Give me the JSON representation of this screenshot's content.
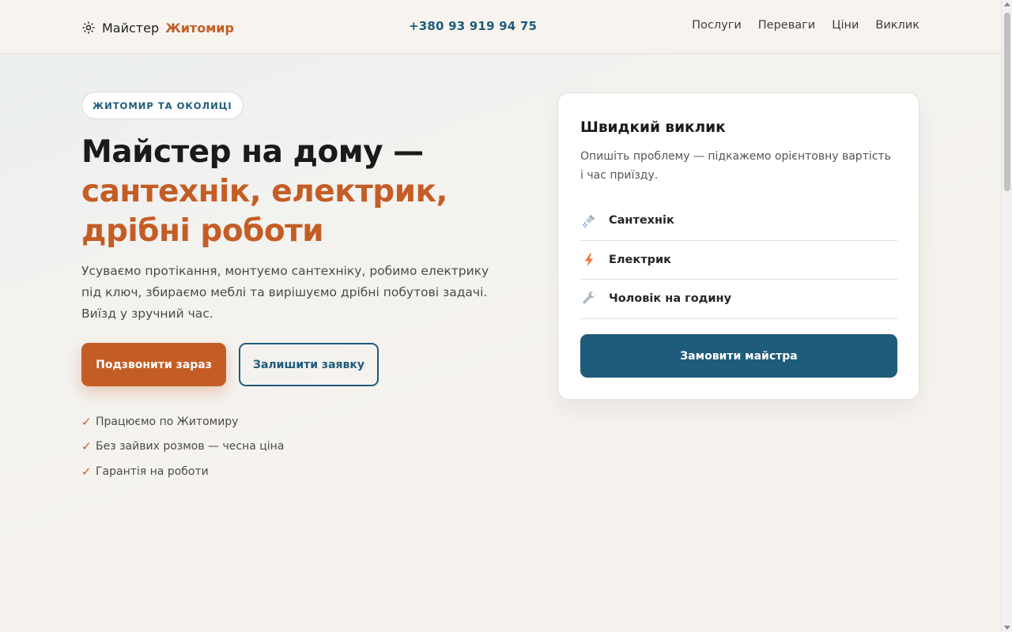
{
  "header": {
    "logo_icon": "gear-icon",
    "logo_text": "Майстер",
    "logo_accent": "Житомир",
    "phone": "+380 93 919 94 75",
    "nav": [
      "Послуги",
      "Переваги",
      "Ціни",
      "Виклик"
    ]
  },
  "hero": {
    "badge": "ЖИТОМИР ТА ОКОЛИЦІ",
    "title_line1": "Майстер на дому —",
    "title_accent": "сантехнік, електрик, дрібні роботи",
    "description": "Усуваємо протікання, монтуємо сантехніку, робимо електрику під ключ, збираємо меблі та вирішуємо дрібні побутові задачі. Виїзд у зручний час.",
    "primary_button": "Подзвонити зараз",
    "secondary_button": "Залишити заявку",
    "check_mark": "✓",
    "checks": [
      "Працюємо по Житомиру",
      "Без зайвих розмов — чесна ціна",
      "Гарантія на роботи"
    ]
  },
  "quick_call": {
    "title": "Швидкий виклик",
    "description": "Опишіть проблему — підкажемо орієнтовну вартість і час приїзду.",
    "services": [
      {
        "label": "Сантехнік",
        "icon": "shower-icon"
      },
      {
        "label": "Електрик",
        "icon": "lightning-icon"
      },
      {
        "label": "Чоловік на годину",
        "icon": "wrench-icon"
      }
    ],
    "order_button": "Замовити майстра"
  },
  "colors": {
    "accent": "#c45d25",
    "brand": "#1f5b7a",
    "background": "#f6f3ef"
  }
}
